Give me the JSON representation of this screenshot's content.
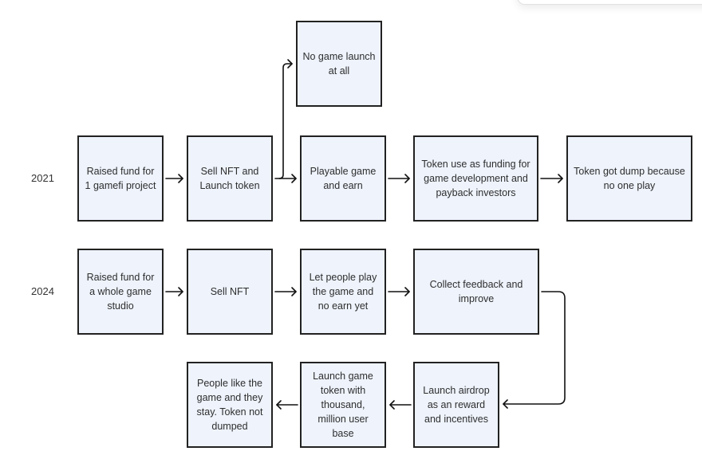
{
  "diagram": {
    "rows": [
      {
        "year": "2021",
        "steps": [
          "Raised fund for 1 gamefi project",
          "Sell NFT and Launch token",
          "Playable game and earn",
          "Token use as funding for game development and payback investors",
          "Token got dump because no one play"
        ],
        "branch": "No game launch at all"
      },
      {
        "year": "2024",
        "steps": [
          "Raised fund for a whole game studio",
          "Sell NFT",
          "Let people play the game and no earn yet",
          "Collect feedback and improve",
          "Launch airdrop as an reward and incentives",
          "Launch game token with thousand, million user base",
          "People like the game and they stay. Token not dumped"
        ]
      }
    ],
    "colors": {
      "box_fill": "#eef3fc",
      "box_border": "#222222",
      "arrow": "#111111"
    }
  }
}
